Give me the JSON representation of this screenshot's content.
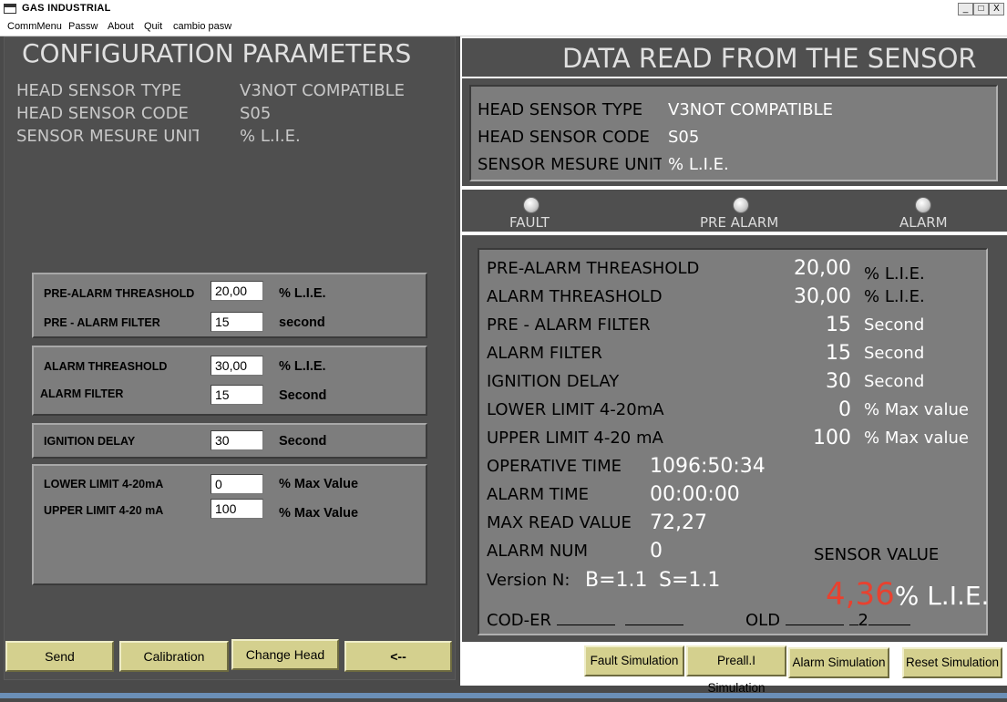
{
  "window": {
    "title": "GAS  INDUSTRIAL",
    "minimize": "_",
    "maximize": "□",
    "close": "X"
  },
  "menu": [
    "CommMenu",
    "Passw",
    "About",
    "Quit",
    "cambio pasw"
  ],
  "config": {
    "title": "CONFIGURATION PARAMETERS",
    "head_sensor_type_label": "HEAD SENSOR TYPE",
    "head_sensor_type_value": "V3NOT COMPATIBLE",
    "head_sensor_code_label": "HEAD SENSOR CODE",
    "head_sensor_code_value": "S05",
    "sensor_unit_label": "SENSOR MESURE UNIT",
    "sensor_unit_value": "% L.I.E.",
    "prealarm_threshold": {
      "label": "PRE-ALARM THREASHOLD",
      "value": "20,00",
      "unit": "% L.I.E."
    },
    "prealarm_filter": {
      "label": "PRE - ALARM FILTER",
      "value": "15",
      "unit": "second"
    },
    "alarm_threshold": {
      "label": "ALARM THREASHOLD",
      "value": "30,00",
      "unit": "% L.I.E."
    },
    "alarm_filter": {
      "label": "ALARM FILTER",
      "value": "15",
      "unit": "Second"
    },
    "ignition_delay": {
      "label": "IGNITION DELAY",
      "value": "30",
      "unit": "Second"
    },
    "lower_limit": {
      "label": "LOWER LIMIT 4-20mA",
      "value": "0",
      "unit": "% Max Value"
    },
    "upper_limit": {
      "label": "UPPER LIMIT 4-20 mA",
      "value": "100",
      "unit": "% Max Value"
    }
  },
  "buttons": {
    "send": "Send",
    "calibration": "Calibration",
    "change_head": "Change Head",
    "back": "<--"
  },
  "sensor": {
    "title": "DATA READ FROM THE SENSOR",
    "head_sensor_type_label": "HEAD SENSOR TYPE",
    "head_sensor_type_value": "V3NOT COMPATIBLE",
    "head_sensor_code_label": "HEAD SENSOR CODE",
    "head_sensor_code_value": "S05",
    "sensor_unit_label": "SENSOR MESURE UNIT",
    "sensor_unit_value": "% L.I.E.",
    "leds": {
      "fault": "FAULT",
      "pre_alarm": "PRE ALARM",
      "alarm": "ALARM"
    },
    "rows": [
      {
        "label": "PRE-ALARM THREASHOLD",
        "value": "20,00",
        "unit": "% L.I.E."
      },
      {
        "label": "ALARM THREASHOLD",
        "value": "30,00",
        "unit": "% L.I.E."
      },
      {
        "label": "PRE - ALARM FILTER",
        "value": "15",
        "unit": "Second"
      },
      {
        "label": "ALARM FILTER",
        "value": "15",
        "unit": "Second"
      },
      {
        "label": "IGNITION DELAY",
        "value": "30",
        "unit": "Second"
      },
      {
        "label": "LOWER LIMIT 4-20mA",
        "value": "0",
        "unit": "% Max value"
      },
      {
        "label": "UPPER LIMIT 4-20 mA",
        "value": "100",
        "unit": "% Max value"
      }
    ],
    "operative_time_label": "OPERATIVE TIME",
    "operative_time_value": "1096:50:34",
    "alarm_time_label": "ALARM TIME",
    "alarm_time_value": "00:00:00",
    "max_read_label": "MAX READ VALUE",
    "max_read_value": "72,27",
    "alarm_num_label": "ALARM NUM",
    "alarm_num_value": "0",
    "version_label": "Version N:",
    "version_b": "B=1.1",
    "version_s": "S=1.1",
    "sensor_value_label": "SENSOR VALUE",
    "sensor_value": "4,36",
    "sensor_value_unit": "% L.I.E.",
    "sensor_value_color": "#e8412f",
    "cod_er_label": "COD-ER",
    "old_label": "OLD",
    "old_value": "2"
  },
  "sim_buttons": {
    "fault": "Fault Simulation",
    "preall": "Preall.I Simulation",
    "alarm": "Alarm Simulation",
    "reset": "Reset Simulation"
  }
}
